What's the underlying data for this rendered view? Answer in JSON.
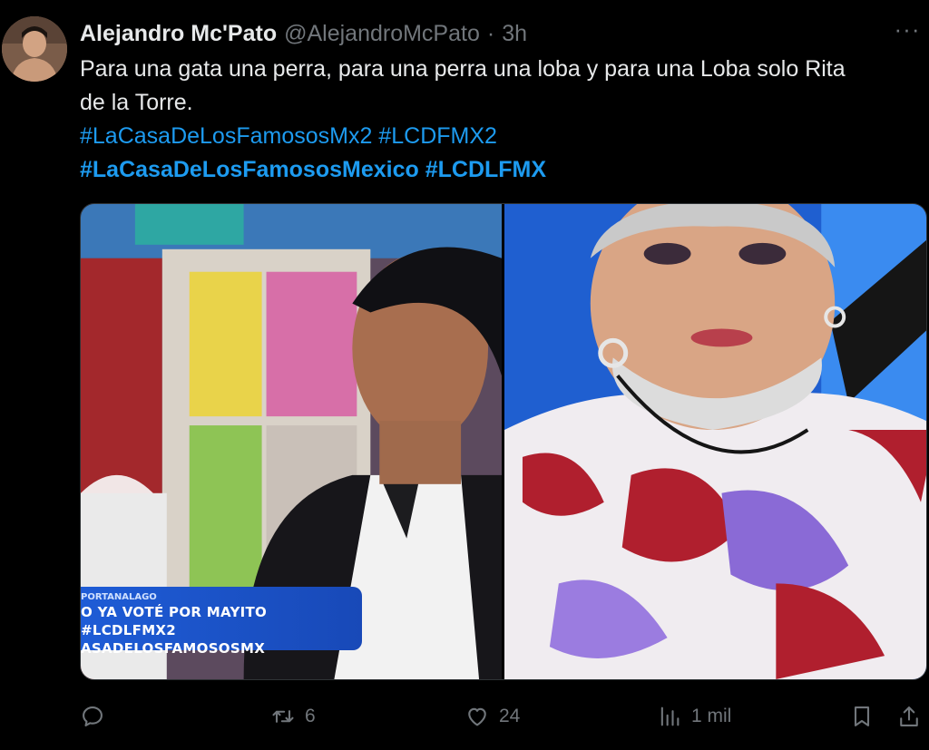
{
  "author": {
    "display_name": "Alejandro Mc'Pato",
    "handle": "@AlejandroMcPato",
    "separator": "·",
    "time": "3h"
  },
  "more_label": "···",
  "tweet": {
    "line1": "Para una gata una perra, para una perra una loba y para una Loba solo Rita",
    "line2": "de la Torre.",
    "hashtags_row1": [
      "#LaCasaDeLosFamososMx2",
      "#LCDFMX2"
    ],
    "hashtags_row2": [
      "#LaCasaDeLosFamososMexico",
      "#LCDLFMX"
    ]
  },
  "media": {
    "banner_top": "PORTANALAGO",
    "banner_line1": "O YA VOTÉ POR MAYITO #LCDLFMX2",
    "banner_line2": "ASADELOSFAMOSOSMX"
  },
  "actions": {
    "reply_count": "",
    "retweet_count": "6",
    "like_count": "24",
    "views_count": "1 mil"
  },
  "colors": {
    "background": "#000000",
    "text": "#e7e9ea",
    "muted": "#71767b",
    "link": "#1d9bf0"
  }
}
